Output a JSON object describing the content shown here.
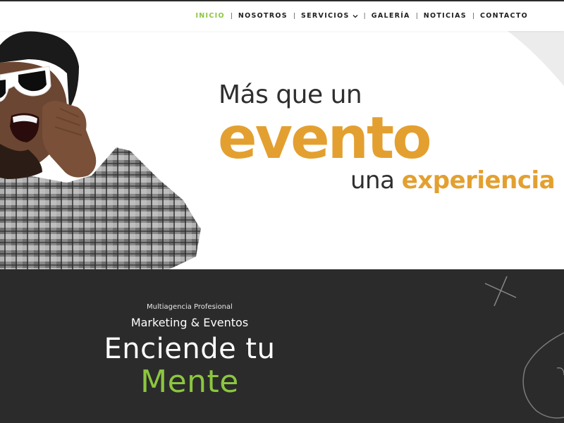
{
  "nav": {
    "items": [
      {
        "label": "INICIO",
        "active": true
      },
      {
        "label": "NOSOTROS",
        "active": false
      },
      {
        "label": "SERVICIOS",
        "active": false,
        "dropdown": true
      },
      {
        "label": "GALERÍA",
        "active": false
      },
      {
        "label": "NOTICIAS",
        "active": false
      },
      {
        "label": "CONTACTO",
        "active": false
      }
    ],
    "separator": "|",
    "dropdown_icon": "chevron-down-icon"
  },
  "hero": {
    "line1": "Más que un",
    "line2": "evento",
    "line3_prefix": "una",
    "line3_accent": "experiencia"
  },
  "section": {
    "subtitle_small": "Multiagencia Profesional",
    "subtitle_main": "Marketing & Eventos",
    "headline": "Enciende tu",
    "headline_accent": "Mente"
  },
  "colors": {
    "accent_green": "#8cc63f",
    "accent_gold": "#e3a030",
    "dark_bg": "#2b2b2b",
    "text_dark": "#2f2f2f"
  }
}
